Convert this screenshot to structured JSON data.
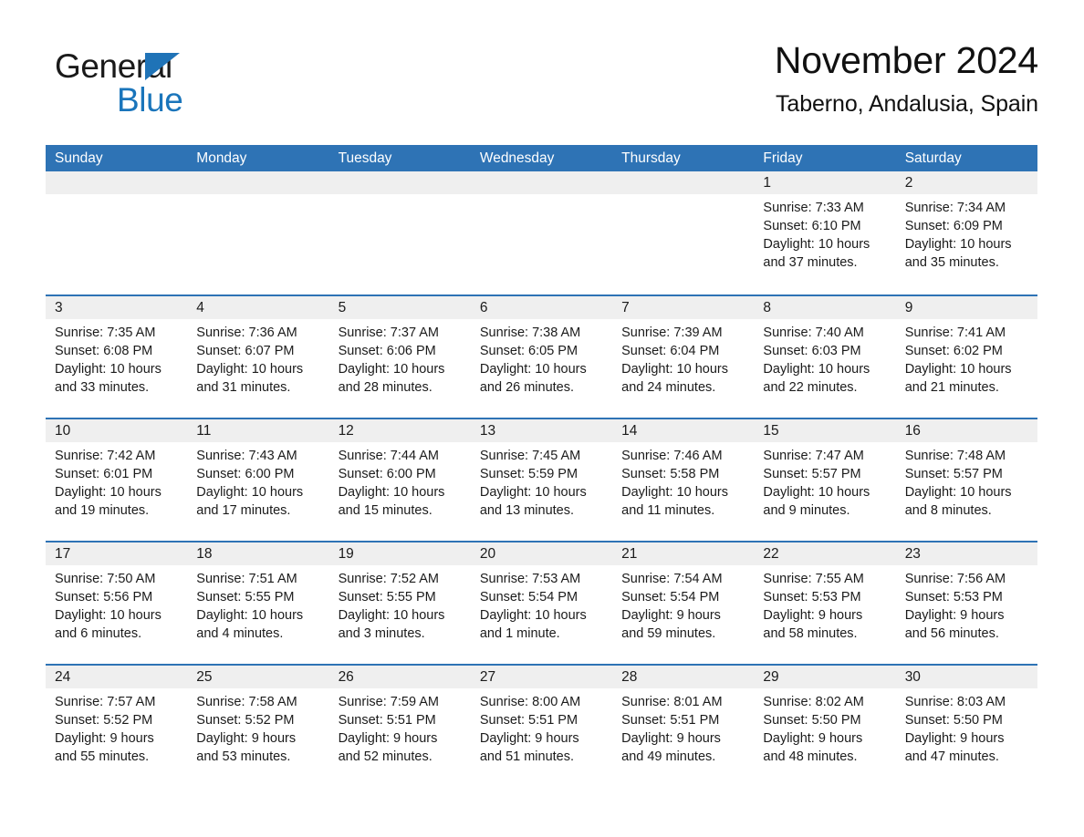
{
  "brand": {
    "name_part1": "General",
    "name_part2": "Blue",
    "triangle_icon": "blue-triangle-icon",
    "accent_color": "#1a75bb"
  },
  "header": {
    "title": "November 2024",
    "subtitle": "Taberno, Andalusia, Spain"
  },
  "theme": {
    "header_bg": "#2e73b5",
    "day_band_bg": "#efefef",
    "divider": "#2e73b5",
    "text": "#1b1b1b"
  },
  "weekdays": [
    "Sunday",
    "Monday",
    "Tuesday",
    "Wednesday",
    "Thursday",
    "Friday",
    "Saturday"
  ],
  "weeks": [
    [
      {
        "day": "",
        "empty": true
      },
      {
        "day": "",
        "empty": true
      },
      {
        "day": "",
        "empty": true
      },
      {
        "day": "",
        "empty": true
      },
      {
        "day": "",
        "empty": true
      },
      {
        "day": "1",
        "sunrise": "Sunrise: 7:33 AM",
        "sunset": "Sunset: 6:10 PM",
        "daylight1": "Daylight: 10 hours",
        "daylight2": "and 37 minutes."
      },
      {
        "day": "2",
        "sunrise": "Sunrise: 7:34 AM",
        "sunset": "Sunset: 6:09 PM",
        "daylight1": "Daylight: 10 hours",
        "daylight2": "and 35 minutes."
      }
    ],
    [
      {
        "day": "3",
        "sunrise": "Sunrise: 7:35 AM",
        "sunset": "Sunset: 6:08 PM",
        "daylight1": "Daylight: 10 hours",
        "daylight2": "and 33 minutes."
      },
      {
        "day": "4",
        "sunrise": "Sunrise: 7:36 AM",
        "sunset": "Sunset: 6:07 PM",
        "daylight1": "Daylight: 10 hours",
        "daylight2": "and 31 minutes."
      },
      {
        "day": "5",
        "sunrise": "Sunrise: 7:37 AM",
        "sunset": "Sunset: 6:06 PM",
        "daylight1": "Daylight: 10 hours",
        "daylight2": "and 28 minutes."
      },
      {
        "day": "6",
        "sunrise": "Sunrise: 7:38 AM",
        "sunset": "Sunset: 6:05 PM",
        "daylight1": "Daylight: 10 hours",
        "daylight2": "and 26 minutes."
      },
      {
        "day": "7",
        "sunrise": "Sunrise: 7:39 AM",
        "sunset": "Sunset: 6:04 PM",
        "daylight1": "Daylight: 10 hours",
        "daylight2": "and 24 minutes."
      },
      {
        "day": "8",
        "sunrise": "Sunrise: 7:40 AM",
        "sunset": "Sunset: 6:03 PM",
        "daylight1": "Daylight: 10 hours",
        "daylight2": "and 22 minutes."
      },
      {
        "day": "9",
        "sunrise": "Sunrise: 7:41 AM",
        "sunset": "Sunset: 6:02 PM",
        "daylight1": "Daylight: 10 hours",
        "daylight2": "and 21 minutes."
      }
    ],
    [
      {
        "day": "10",
        "sunrise": "Sunrise: 7:42 AM",
        "sunset": "Sunset: 6:01 PM",
        "daylight1": "Daylight: 10 hours",
        "daylight2": "and 19 minutes."
      },
      {
        "day": "11",
        "sunrise": "Sunrise: 7:43 AM",
        "sunset": "Sunset: 6:00 PM",
        "daylight1": "Daylight: 10 hours",
        "daylight2": "and 17 minutes."
      },
      {
        "day": "12",
        "sunrise": "Sunrise: 7:44 AM",
        "sunset": "Sunset: 6:00 PM",
        "daylight1": "Daylight: 10 hours",
        "daylight2": "and 15 minutes."
      },
      {
        "day": "13",
        "sunrise": "Sunrise: 7:45 AM",
        "sunset": "Sunset: 5:59 PM",
        "daylight1": "Daylight: 10 hours",
        "daylight2": "and 13 minutes."
      },
      {
        "day": "14",
        "sunrise": "Sunrise: 7:46 AM",
        "sunset": "Sunset: 5:58 PM",
        "daylight1": "Daylight: 10 hours",
        "daylight2": "and 11 minutes."
      },
      {
        "day": "15",
        "sunrise": "Sunrise: 7:47 AM",
        "sunset": "Sunset: 5:57 PM",
        "daylight1": "Daylight: 10 hours",
        "daylight2": "and 9 minutes."
      },
      {
        "day": "16",
        "sunrise": "Sunrise: 7:48 AM",
        "sunset": "Sunset: 5:57 PM",
        "daylight1": "Daylight: 10 hours",
        "daylight2": "and 8 minutes."
      }
    ],
    [
      {
        "day": "17",
        "sunrise": "Sunrise: 7:50 AM",
        "sunset": "Sunset: 5:56 PM",
        "daylight1": "Daylight: 10 hours",
        "daylight2": "and 6 minutes."
      },
      {
        "day": "18",
        "sunrise": "Sunrise: 7:51 AM",
        "sunset": "Sunset: 5:55 PM",
        "daylight1": "Daylight: 10 hours",
        "daylight2": "and 4 minutes."
      },
      {
        "day": "19",
        "sunrise": "Sunrise: 7:52 AM",
        "sunset": "Sunset: 5:55 PM",
        "daylight1": "Daylight: 10 hours",
        "daylight2": "and 3 minutes."
      },
      {
        "day": "20",
        "sunrise": "Sunrise: 7:53 AM",
        "sunset": "Sunset: 5:54 PM",
        "daylight1": "Daylight: 10 hours",
        "daylight2": "and 1 minute."
      },
      {
        "day": "21",
        "sunrise": "Sunrise: 7:54 AM",
        "sunset": "Sunset: 5:54 PM",
        "daylight1": "Daylight: 9 hours",
        "daylight2": "and 59 minutes."
      },
      {
        "day": "22",
        "sunrise": "Sunrise: 7:55 AM",
        "sunset": "Sunset: 5:53 PM",
        "daylight1": "Daylight: 9 hours",
        "daylight2": "and 58 minutes."
      },
      {
        "day": "23",
        "sunrise": "Sunrise: 7:56 AM",
        "sunset": "Sunset: 5:53 PM",
        "daylight1": "Daylight: 9 hours",
        "daylight2": "and 56 minutes."
      }
    ],
    [
      {
        "day": "24",
        "sunrise": "Sunrise: 7:57 AM",
        "sunset": "Sunset: 5:52 PM",
        "daylight1": "Daylight: 9 hours",
        "daylight2": "and 55 minutes."
      },
      {
        "day": "25",
        "sunrise": "Sunrise: 7:58 AM",
        "sunset": "Sunset: 5:52 PM",
        "daylight1": "Daylight: 9 hours",
        "daylight2": "and 53 minutes."
      },
      {
        "day": "26",
        "sunrise": "Sunrise: 7:59 AM",
        "sunset": "Sunset: 5:51 PM",
        "daylight1": "Daylight: 9 hours",
        "daylight2": "and 52 minutes."
      },
      {
        "day": "27",
        "sunrise": "Sunrise: 8:00 AM",
        "sunset": "Sunset: 5:51 PM",
        "daylight1": "Daylight: 9 hours",
        "daylight2": "and 51 minutes."
      },
      {
        "day": "28",
        "sunrise": "Sunrise: 8:01 AM",
        "sunset": "Sunset: 5:51 PM",
        "daylight1": "Daylight: 9 hours",
        "daylight2": "and 49 minutes."
      },
      {
        "day": "29",
        "sunrise": "Sunrise: 8:02 AM",
        "sunset": "Sunset: 5:50 PM",
        "daylight1": "Daylight: 9 hours",
        "daylight2": "and 48 minutes."
      },
      {
        "day": "30",
        "sunrise": "Sunrise: 8:03 AM",
        "sunset": "Sunset: 5:50 PM",
        "daylight1": "Daylight: 9 hours",
        "daylight2": "and 47 minutes."
      }
    ]
  ]
}
